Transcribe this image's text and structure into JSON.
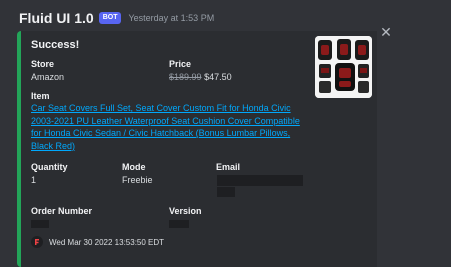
{
  "message": {
    "username": "Fluid UI 1.0",
    "bot_badge": "BOT",
    "timestamp": "Yesterday at 1:53 PM"
  },
  "embed": {
    "accent_color": "#23a559",
    "title": "Success!",
    "store": {
      "label": "Store",
      "value": "Amazon"
    },
    "price": {
      "label": "Price",
      "old": "$189.99",
      "new": "$47.50"
    },
    "item": {
      "label": "Item",
      "link_text": "Car Seat Covers Full Set, Seat Cover Custom Fit for Honda Civic 2003-2021 PU Leather Waterproof Seat Cushion Cover Compatible for Honda Civic Sedan / Civic Hatchback (Bonus Lumbar Pillows, Black Red)"
    },
    "quantity": {
      "label": "Quantity",
      "value": "1"
    },
    "mode": {
      "label": "Mode",
      "value": "Freebie"
    },
    "email": {
      "label": "Email"
    },
    "order_number": {
      "label": "Order Number"
    },
    "version": {
      "label": "Version"
    },
    "footer": {
      "text": "Wed Mar 30 2022 13:53:50 EDT"
    },
    "thumbnail": {
      "alt": "car-seat-covers-product-image"
    }
  },
  "icons": {
    "close": "close-icon",
    "footer": "footer-logo-icon"
  }
}
